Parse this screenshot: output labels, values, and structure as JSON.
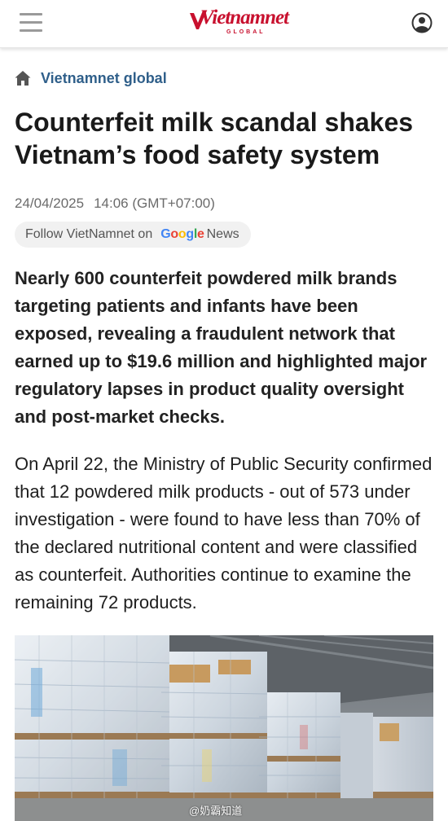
{
  "header": {
    "logo_text": "Vietnamnet",
    "logo_sub": "GLOBAL",
    "menu_icon": "hamburger-menu-icon",
    "account_icon": "user-account-icon"
  },
  "breadcrumb": {
    "icon": "home-icon",
    "label": "Vietnamnet global"
  },
  "article": {
    "title": "Counterfeit milk scandal shakes Vietnam’s food safety system",
    "date": "24/04/2025",
    "time": "14:06 (GMT+07:00)",
    "follow": {
      "text": "Follow VietNamnet on",
      "google": "Google",
      "news": "News"
    },
    "lead": "Nearly 600 counterfeit powdered milk brands targeting patients and infants have been exposed, revealing a fraudulent network that earned up to $19.6 million and highlighted major regulatory lapses in product quality oversight and post-market checks.",
    "body": "On April 22, the Ministry of Public Security confirmed that 12 powdered milk products - out of 573 under investigation - were found to have less than 70% of the declared nutritional content and were classified as counterfeit. Authorities continue to examine the remaining 72 products."
  },
  "watermark": "@奶霸知道",
  "colors": {
    "brand_red": "#c8102e",
    "link_blue": "#2f5f8a",
    "meta_gray": "#6b6b6b"
  }
}
